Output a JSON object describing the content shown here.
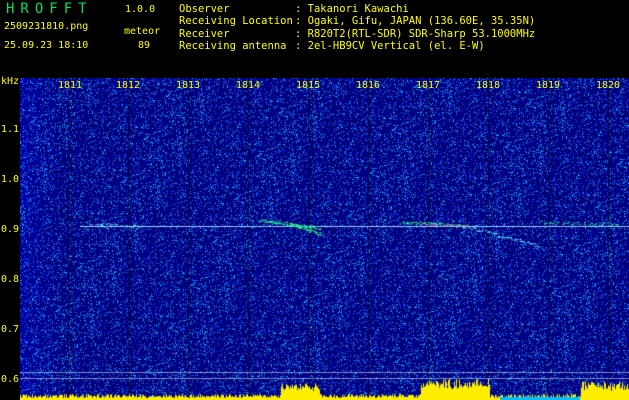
{
  "app": {
    "name": "HROFFT",
    "version": "1.0.0"
  },
  "file": {
    "name": "2509231810.png",
    "datetime": "25.09.23 18:10",
    "mode": "meteor",
    "count": "89"
  },
  "info": [
    {
      "label": "Observer",
      "value": ": Takanori Kawachi"
    },
    {
      "label": "Receiving Location",
      "value": ": Ogaki, Gifu, JAPAN (136.60E, 35.35N)"
    },
    {
      "label": "Receiver",
      "value": ": R820T2(RTL-SDR) SDR-Sharp 53.1000MHz"
    },
    {
      "label": "Receiving antenna",
      "value": ": 2el-HB9CV Vertical (el. E-W)"
    }
  ],
  "axis": {
    "unit": "kHz",
    "y_labels": [
      "1.1",
      "1.0",
      "0.9",
      "0.8",
      "0.7",
      "0.6"
    ],
    "x_labels": [
      "1811",
      "1812",
      "1813",
      "1814",
      "1815",
      "1816",
      "1817",
      "1818",
      "1819",
      "1820"
    ]
  },
  "colors": {
    "text": "#ffff00",
    "background": "#000000",
    "spectrum_low": "#00008b",
    "echo": "#00ff80"
  }
}
